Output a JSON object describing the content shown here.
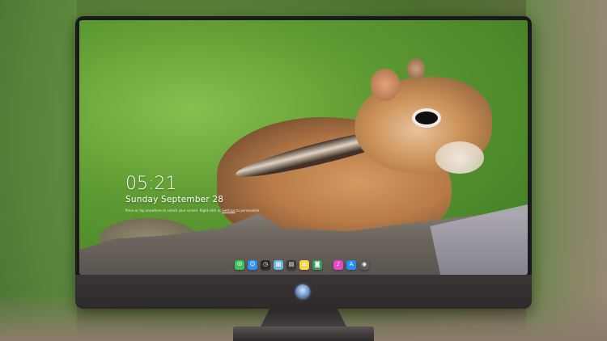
{
  "lock_screen": {
    "time": "05:21",
    "date": "Sunday September 28",
    "notice_prefix": "Press or tap anywhere to unlock your screen. Right-click or",
    "notice_link": "Settings",
    "notice_suffix": "to personalize"
  },
  "dock": {
    "icons": [
      {
        "name": "messages-icon",
        "color": "#3cc25a",
        "glyph": "✉"
      },
      {
        "name": "finder-icon",
        "color": "#2f8ff0",
        "glyph": "☺"
      },
      {
        "name": "clock-icon",
        "color": "#2b2b2b",
        "glyph": "◷"
      },
      {
        "name": "preview-icon",
        "color": "#6fb6e8",
        "glyph": "▦"
      },
      {
        "name": "clapper-icon",
        "color": "#3a3a3a",
        "glyph": "▤"
      },
      {
        "name": "notes-icon",
        "color": "#f6d54a",
        "glyph": "≡"
      },
      {
        "name": "photo-booth-icon",
        "color": "#3c9c60",
        "glyph": "◙"
      },
      {
        "name": "itunes-icon",
        "color": "#e24bc5",
        "glyph": "♪"
      },
      {
        "name": "app-store-icon",
        "color": "#2a8cf0",
        "glyph": "A"
      },
      {
        "name": "camera-icon",
        "color": "#5a5a5a",
        "glyph": "◉"
      }
    ]
  },
  "colors": {
    "bezel": "#1a1a1c",
    "chin": "#322e2f",
    "wallpaper_green": "#5e9a32"
  }
}
